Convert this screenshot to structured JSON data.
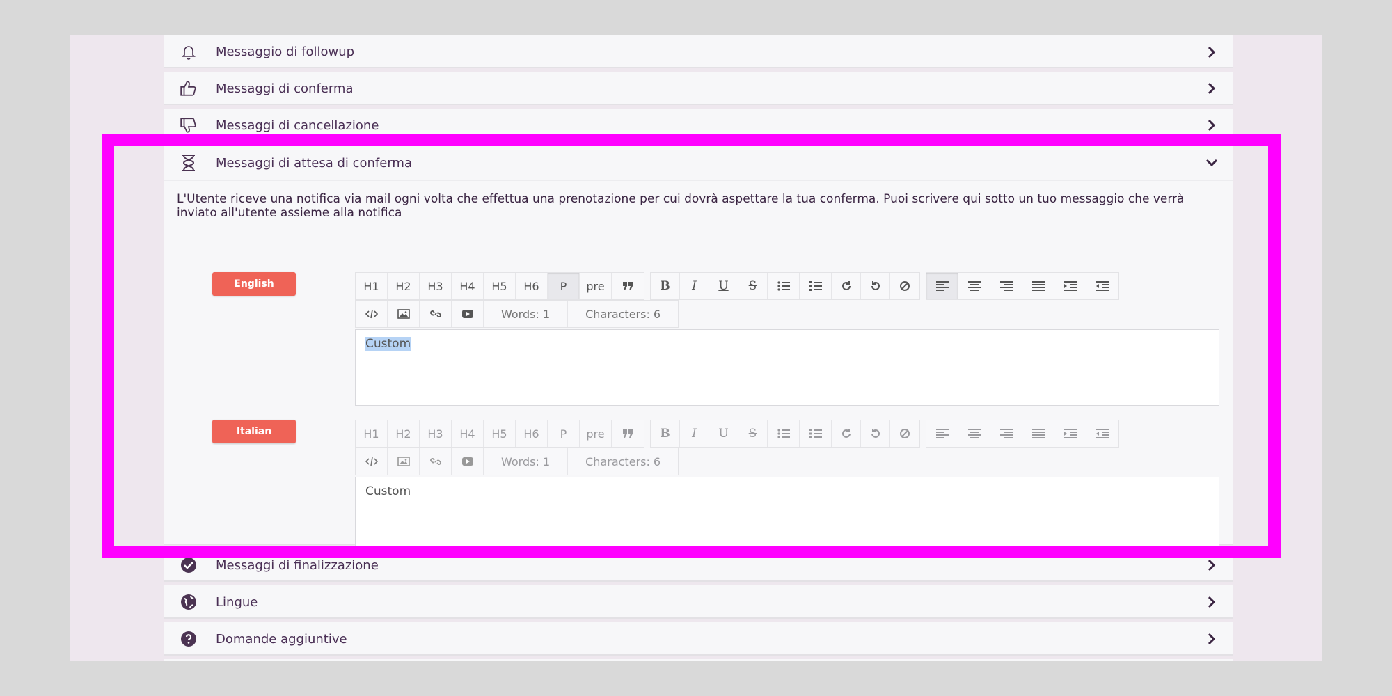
{
  "accordion": {
    "followup": {
      "title": "Messaggio di followup",
      "icon": "bell-icon"
    },
    "conferma": {
      "title": "Messaggi di conferma",
      "icon": "thumbs-up-icon"
    },
    "cancellazione": {
      "title": "Messaggi di cancellazione",
      "icon": "thumbs-down-icon"
    },
    "attesa": {
      "title": "Messaggi di attesa di conferma",
      "icon": "hourglass-icon",
      "description": "L'Utente riceve una notifica via mail ogni volta che effettua una prenotazione per cui dovrà aspettare la tua conferma. Puoi scrivere qui sotto un tuo messaggio che verrà inviato all'utente assieme alla notifica",
      "editors": [
        {
          "language": "English",
          "words": "Words: 1",
          "characters": "Characters: 6",
          "content": "Custom",
          "content_selected": true
        },
        {
          "language": "Italian",
          "words": "Words: 1",
          "characters": "Characters: 6",
          "content": "Custom",
          "content_selected": false
        }
      ]
    },
    "finalizzazione": {
      "title": "Messaggi di finalizzazione",
      "icon": "check-circle-icon"
    },
    "lingue": {
      "title": "Lingue",
      "icon": "globe-icon"
    },
    "domande": {
      "title": "Domande aggiuntive",
      "icon": "question-circle-icon"
    }
  },
  "toolbar": {
    "headings": [
      "H1",
      "H2",
      "H3",
      "H4",
      "H5",
      "H6",
      "P",
      "pre"
    ],
    "active_block": "P"
  },
  "colors": {
    "language_button": "#ef6357",
    "highlight_border": "#ff00ff",
    "title_text": "#4a2f55"
  }
}
